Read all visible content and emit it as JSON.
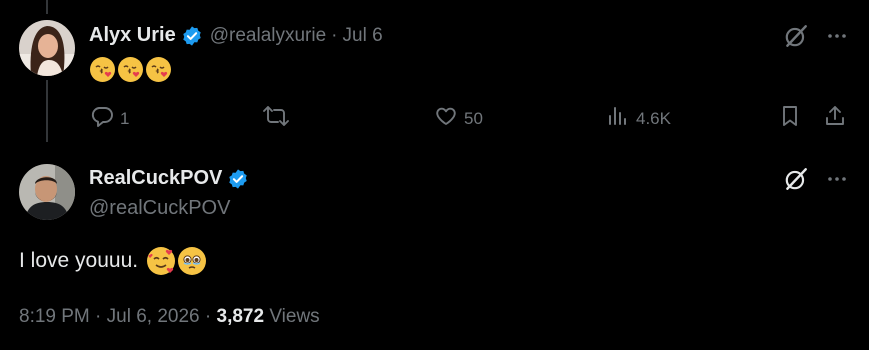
{
  "reply_tweet": {
    "display_name": "Alyx Urie",
    "handle": "@realalyxurie",
    "separator": "·",
    "date": "Jul 6",
    "emojis": [
      "kissing-heart-emoji",
      "kissing-heart-emoji",
      "kissing-heart-emoji"
    ],
    "actions": {
      "replies": "1",
      "retweets": "",
      "likes": "50",
      "views": "4.6K"
    }
  },
  "main_tweet": {
    "display_name": "RealCuckPOV",
    "handle": "@realCuckPOV",
    "text": "I love youuu.",
    "emojis": [
      "smiling-face-with-hearts-emoji",
      "holding-back-tears-emoji"
    ],
    "time": "8:19 PM",
    "separator": "·",
    "date": "Jul 6, 2026",
    "views_count": "3,872",
    "views_label": "Views"
  },
  "colors": {
    "background": "#000000",
    "primary_text": "#e7e9ea",
    "secondary_text": "#71767b",
    "verified": "#1d9bf0",
    "thread_line": "#333639"
  }
}
